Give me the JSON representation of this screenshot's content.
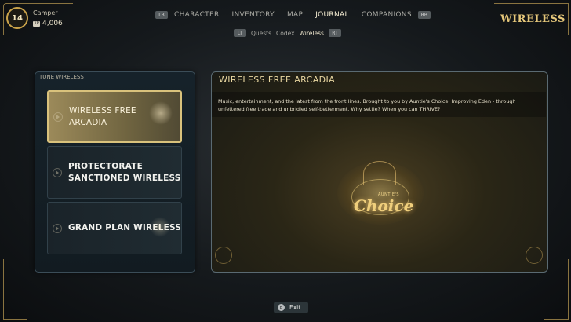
{
  "player": {
    "level": "14",
    "name": "Camper",
    "xp_icon": "XP",
    "currency": "4,006"
  },
  "nav": {
    "left_button": "LB",
    "right_button": "RB",
    "tabs": [
      "CHARACTER",
      "INVENTORY",
      "MAP",
      "JOURNAL",
      "COMPANIONS"
    ],
    "active_tab": "JOURNAL"
  },
  "subnav": {
    "left_button": "LT",
    "right_button": "RT",
    "items": [
      "Quests",
      "Codex",
      "Wireless"
    ],
    "active_item": "Wireless"
  },
  "screen_title": "WIRELESS",
  "stations_panel": {
    "header": "TUNE WIRELESS",
    "stations": [
      {
        "label_line1": "WIRELESS FREE",
        "label_line2": "ARCADIA",
        "selected": true
      },
      {
        "label_line1": "PROTECTORATE",
        "label_line2": "SANCTIONED WIRELESS",
        "selected": false
      },
      {
        "label_line1": "GRAND PLAN WIRELESS",
        "label_line2": "",
        "selected": false
      }
    ]
  },
  "detail": {
    "title": "WIRELESS FREE ARCADIA",
    "description": "Music, entertainment, and the latest from the front lines. Brought to you by Auntie's Choice: Improving Eden - through unfettered free trade and unbridled self-betterment. Why settle? When you can THRIVE?",
    "logo_small": "AUNTIE'S",
    "logo_main": "Choice"
  },
  "footer": {
    "exit_key": "B",
    "exit_label": "Exit"
  },
  "colors": {
    "accent_gold": "#e5c77a",
    "selected_fill": "#9c8a5a",
    "panel_border": "#3b4d58"
  }
}
